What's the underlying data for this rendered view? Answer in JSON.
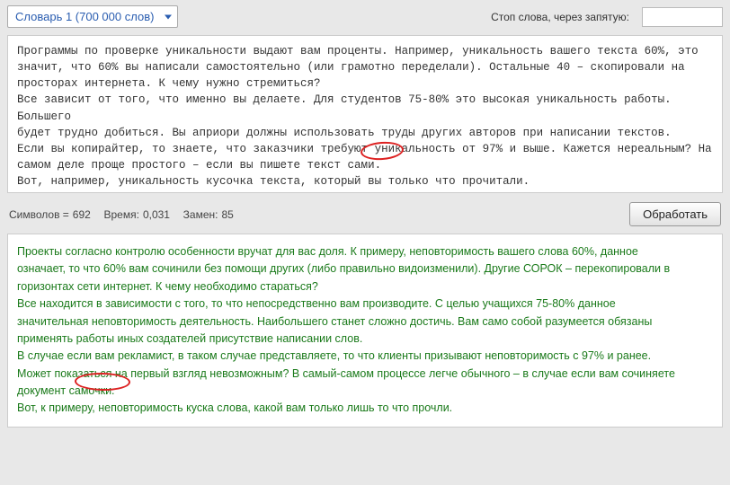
{
  "topbar": {
    "dictionary_label": "Словарь 1 (700 000 слов)",
    "stop_words_label": "Стоп слова, через запятую:",
    "stop_words_value": ""
  },
  "input_text": {
    "lines": [
      "Программы по проверке уникальности выдают вам проценты. Например, уникальность вашего текста 60%, это",
      "значит, что 60% вы написали самостоятельно (или грамотно переделали). Остальные 40 – скопировали на",
      "просторах интернета. К чему нужно стремиться?",
      "Все зависит от того, что именно  вы делаете. Для студентов 75-80% это высокая уникальность работы. Большего",
      "будет трудно добиться. Вы априори должны использовать труды других авторов при написании текстов.",
      " Если вы копирайтер, то знаете, что заказчики требуют уникальность от 97% и выше. Кажется нереальным? На",
      "самом деле проще простого – если вы пишете текст сами.",
      "Вот, например, уникальность кусочка текста, который вы только что прочитали."
    ]
  },
  "stats": {
    "chars_label": "Символов =",
    "chars_value": "692",
    "time_label": "Время:",
    "time_value": "0,031",
    "repl_label": "Замен:",
    "repl_value": "85",
    "process_button": "Обработать"
  },
  "output_text": {
    "lines": [
      "Проекты согласно контролю особенности вручат для вас доля. К примеру, неповторимость вашего слова 60%, данное",
      "означает, то что 60% вам сочинили без помощи других (либо правильно видоизменили). Другие СОРОК – перекопировали в",
      "горизонтах сети интернет. К чему необходимо стараться?",
      "Все находится в зависимости с того, то что непосредственно вам производите. С целью учащихся 75-80% данное",
      "значительная неповторимость деятельность. Наибольшего станет сложно достичь. Вам само собой разумеется обязаны",
      "применять работы иных создателей присутствие написании слов.",
      "В случае если вам рекламист, в таком случае представляете, то что клиенты призывают неповторимость с 97% и ранее.",
      "Может показаться на первый взгляд невозможным? В самый-самом процессе легче обычного – в случае если вам сочиняете",
      "документ самочки.",
      "Вот, к примеру, неповторимость куска слова, какой вам только лишь то что прочли."
    ]
  }
}
